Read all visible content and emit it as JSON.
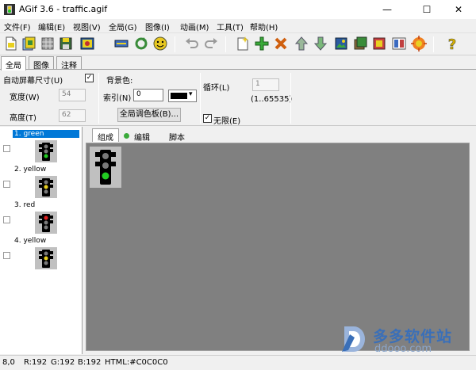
{
  "window": {
    "title": "AGif 3.6 - traffic.agif",
    "minimize_glyph": "—",
    "maximize_glyph": "☐",
    "close_glyph": "✕"
  },
  "menu": [
    "文件(F)",
    "编辑(E)",
    "视图(V)",
    "全局(G)",
    "图像(I)",
    "动画(M)",
    "工具(T)",
    "帮助(H)"
  ],
  "toolbar": {
    "buttons": [
      "new-file",
      "open-folder",
      "grid",
      "save-disk",
      "export-image",
      "optimize",
      "rotate",
      "smiley",
      "undo",
      "redo",
      "new-frame",
      "add-frame",
      "delete-frame",
      "move-up",
      "move-down",
      "import-image",
      "frame-settings",
      "replace-frame",
      "preview",
      "effects",
      "help"
    ]
  },
  "tabs": [
    "全局",
    "图像",
    "注释"
  ],
  "global_props": {
    "auto_screen_size_label": "自动屏幕尺寸(U)",
    "auto_screen_size_checked": "✓",
    "width_label": "宽度(W)",
    "width_value": "54",
    "height_label": "高度(T)",
    "height_value": "62",
    "bg_color_label": "背景色:",
    "index_label": "索引(N)",
    "index_value": "0",
    "dropdown_glyph": "▾",
    "palette_button": "全局调色板(B)...",
    "loop_label": "循环(L)",
    "loop_value": "1",
    "loop_range": "(1..65535)",
    "infinite_label": "无限(E)",
    "infinite_checked": "✓"
  },
  "frames": [
    {
      "label": "1. green",
      "light": "green"
    },
    {
      "label": "2. yellow",
      "light": "yellow"
    },
    {
      "label": "3. red",
      "light": "red"
    },
    {
      "label": "4. yellow",
      "light": "yellow"
    }
  ],
  "canvas_tabs": [
    "组成",
    "编辑",
    "脚本"
  ],
  "status": {
    "coords": "8,0",
    "r": "R:192",
    "g": "G:192",
    "b": "B:192",
    "html": "HTML:#C0C0C0"
  },
  "watermark": {
    "text": "多多软件站",
    "url": "ddooo.com"
  },
  "colors": {
    "green": "#22cc22",
    "yellow": "#e8d020",
    "red": "#e02020",
    "off": "#7a7a7a",
    "canvas": "#808080",
    "selection": "#0078d7"
  }
}
